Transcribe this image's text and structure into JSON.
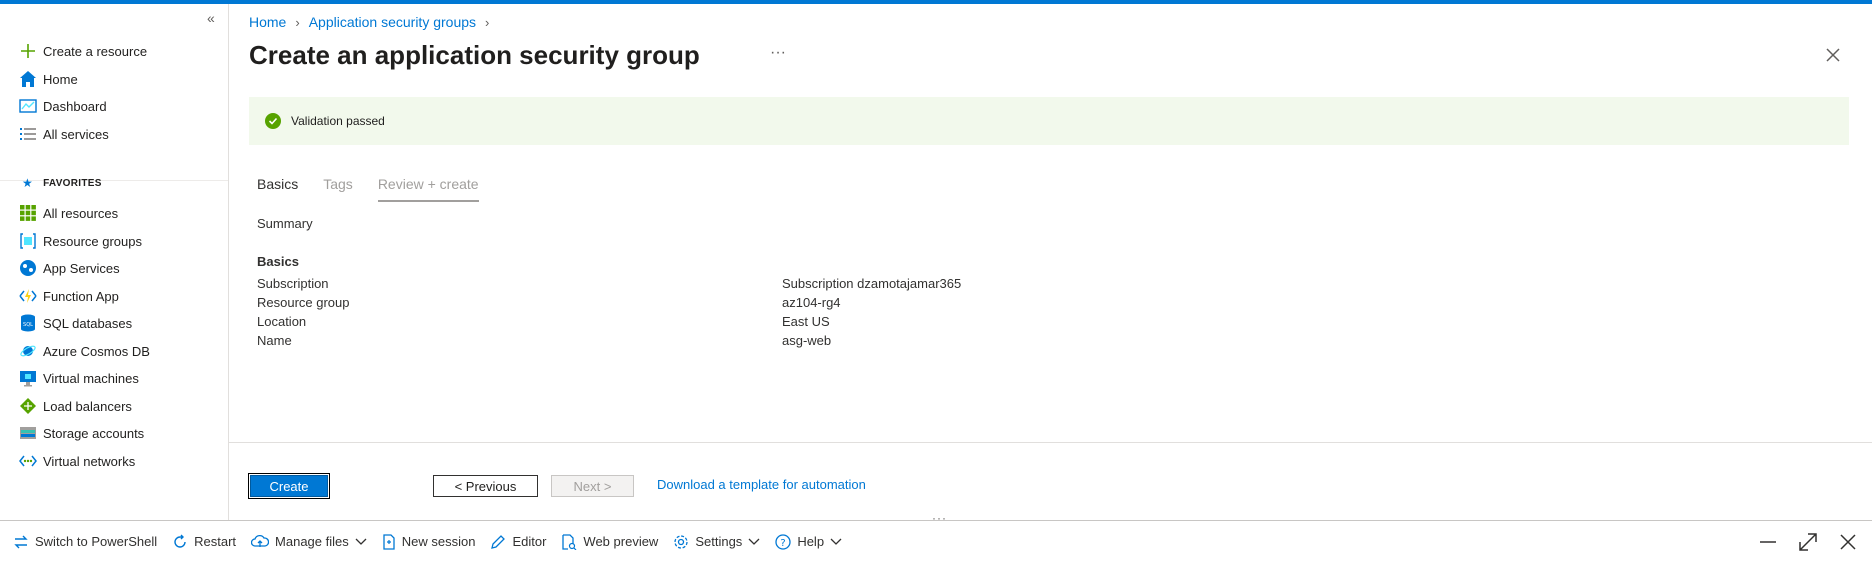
{
  "sidebar": {
    "collapse_icon": "«",
    "items": [
      {
        "label": "Create a resource",
        "icon": "plus-icon"
      },
      {
        "label": "Home",
        "icon": "home-icon"
      },
      {
        "label": "Dashboard",
        "icon": "dashboard-icon"
      },
      {
        "label": "All services",
        "icon": "list-icon"
      }
    ],
    "favorites_label": "FAVORITES",
    "favorites": [
      {
        "label": "All resources",
        "icon": "grid-icon"
      },
      {
        "label": "Resource groups",
        "icon": "resource-group-icon"
      },
      {
        "label": "App Services",
        "icon": "globe-icon"
      },
      {
        "label": "Function App",
        "icon": "lightning-icon"
      },
      {
        "label": "SQL databases",
        "icon": "sql-icon"
      },
      {
        "label": "Azure Cosmos DB",
        "icon": "planet-icon"
      },
      {
        "label": "Virtual machines",
        "icon": "monitor-icon"
      },
      {
        "label": "Load balancers",
        "icon": "diamond-icon"
      },
      {
        "label": "Storage accounts",
        "icon": "storage-icon"
      },
      {
        "label": "Virtual networks",
        "icon": "network-icon"
      }
    ]
  },
  "breadcrumb": {
    "home": "Home",
    "parent": "Application security groups"
  },
  "page": {
    "title": "Create an application security group",
    "more": "···"
  },
  "validation": {
    "text": "Validation passed"
  },
  "tabs": [
    "Basics",
    "Tags",
    "Review + create"
  ],
  "summary_label": "Summary",
  "basics": {
    "heading": "Basics",
    "rows": [
      {
        "key": "Subscription",
        "value": "Subscription dzamotajamar365"
      },
      {
        "key": "Resource group",
        "value": "az104-rg4"
      },
      {
        "key": "Location",
        "value": "East US"
      },
      {
        "key": "Name",
        "value": "asg-web"
      }
    ]
  },
  "footer": {
    "create": "Create",
    "previous": "< Previous",
    "next": "Next >",
    "template_link": "Download a template for automation"
  },
  "shell": {
    "resize_handle": "···",
    "switch": "Switch to PowerShell",
    "restart": "Restart",
    "manage_files": "Manage files",
    "new_session": "New session",
    "editor": "Editor",
    "web_preview": "Web preview",
    "settings": "Settings",
    "help": "Help"
  },
  "colors": {
    "accent": "#0078d4",
    "success": "#57a300",
    "banner_bg": "#f2f9ec"
  }
}
